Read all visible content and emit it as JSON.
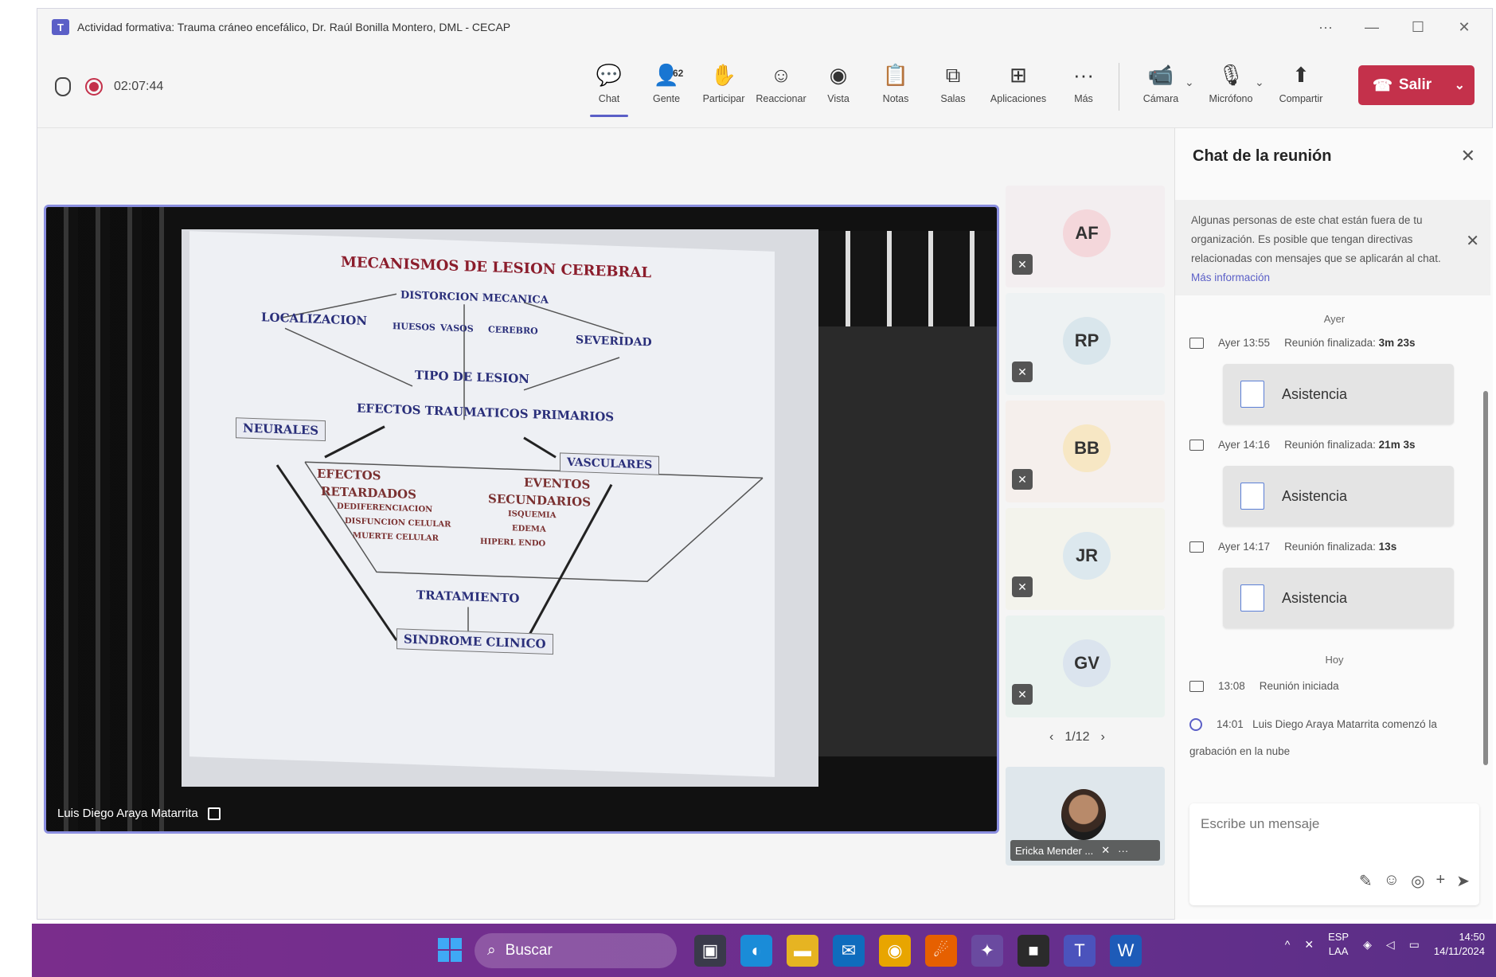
{
  "window": {
    "title": "Actividad formativa: Trauma cráneo encefálico, Dr. Raúl Bonilla Montero, DML - CECAP",
    "controls": [
      "···",
      "—",
      "☐",
      "✕"
    ]
  },
  "toolbar": {
    "timer": "02:07:44",
    "tools": [
      {
        "label": "Chat",
        "icon": "💬"
      },
      {
        "label": "Gente",
        "icon": "👤",
        "badge": "62"
      },
      {
        "label": "Participar",
        "icon": "✋"
      },
      {
        "label": "Reaccionar",
        "icon": "☺"
      },
      {
        "label": "Vista",
        "icon": "◉"
      },
      {
        "label": "Notas",
        "icon": "📋"
      },
      {
        "label": "Salas",
        "icon": "⧉"
      },
      {
        "label": "Aplicaciones",
        "icon": "⊞"
      },
      {
        "label": "Más",
        "icon": "···"
      }
    ],
    "media": [
      {
        "label": "Cámara",
        "icon": "📹"
      },
      {
        "label": "Micrófono",
        "icon": "🎙"
      },
      {
        "label": "Compartir",
        "icon": "⬆"
      }
    ],
    "leave_label": "Salir"
  },
  "stage": {
    "presenter_name": "Luis Diego Araya Matarrita",
    "slide": {
      "title": "MECANISMOS DE LESION CEREBRAL",
      "distorcion": "DISTORCION MECANICA",
      "localizacion": "LOCALIZACION",
      "huesos": "HUESOS",
      "vasos": "VASOS",
      "cerebro": "CEREBRO",
      "severidad": "SEVERIDAD",
      "tipo": "TIPO DE LESION",
      "efectos_primarios": "EFECTOS TRAUMATICOS PRIMARIOS",
      "neurales": "NEURALES",
      "vasculares": "VASCULARES",
      "efectos": "EFECTOS",
      "retardados": "RETARDADOS",
      "dediferenciacion": "DEDIFERENCIACION",
      "disfuncion": "DISFUNCION CELULAR",
      "muerte": "MUERTE CELULAR",
      "eventos": "EVENTOS",
      "secundarios": "SECUNDARIOS",
      "isquemia": "ISQUEMIA",
      "edema": "EDEMA",
      "hiperendo": "HIPERL ENDO",
      "tratamiento": "TRATAMIENTO",
      "sindrome": "SINDROME CLINICO"
    }
  },
  "participants": {
    "tiles": [
      {
        "initials": "AF",
        "color": "#f4d7db"
      },
      {
        "initials": "RP",
        "color": "#d9e6ec"
      },
      {
        "initials": "BB",
        "color": "#f7e7c4"
      },
      {
        "initials": "JR",
        "color": "#dce8ee"
      },
      {
        "initials": "GV",
        "color": "#dbe4ee"
      }
    ],
    "pager": "1/12",
    "self_name": "Ericka Mender ..."
  },
  "chat": {
    "title": "Chat de la reunión",
    "notice": "Algunas personas de este chat están fuera de tu organización. Es posible que tengan directivas relacionadas con mensajes que se aplicarán al chat.",
    "notice_link": "Más información",
    "day_ayer": "Ayer",
    "events": [
      {
        "time": "Ayer 13:55",
        "text": "Reunión finalizada:",
        "duration": "3m 23s",
        "card": "Asistencia"
      },
      {
        "time": "Ayer 14:16",
        "text": "Reunión finalizada:",
        "duration": "21m 3s",
        "card": "Asistencia"
      },
      {
        "time": "Ayer 14:17",
        "text": "Reunión finalizada:",
        "duration": "13s",
        "card": "Asistencia"
      }
    ],
    "day_hoy": "Hoy",
    "started": {
      "time": "13:08",
      "text": "Reunión iniciada"
    },
    "recording": {
      "time": "14:01",
      "text": "Luis Diego Araya Matarrita comenzó la grabación en la nube"
    },
    "compose_placeholder": "Escribe un mensaje"
  },
  "taskbar": {
    "search_label": "Buscar",
    "lang_top": "ESP",
    "lang_bottom": "LAA",
    "time": "14:50",
    "date": "14/11/2024"
  }
}
